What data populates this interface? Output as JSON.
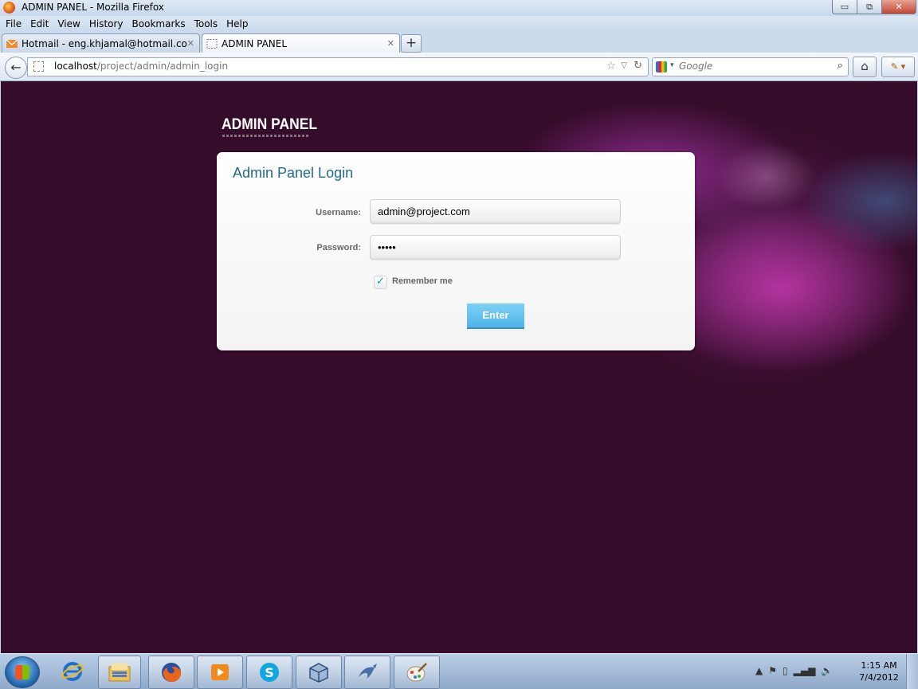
{
  "window": {
    "title": "ADMIN PANEL - Mozilla Firefox",
    "minimize": "▭",
    "restore": "⧉",
    "close": "✕"
  },
  "menu": [
    "File",
    "Edit",
    "View",
    "History",
    "Bookmarks",
    "Tools",
    "Help"
  ],
  "tabs": [
    {
      "label": "Hotmail - eng.khjamal@hotmail.com",
      "icon": "hotmail-icon",
      "close": "✕"
    },
    {
      "label": "ADMIN PANEL",
      "icon": "blank-page-icon",
      "close": "✕"
    }
  ],
  "newtab": "+",
  "nav": {
    "url_host": "localhost",
    "url_path": "/project/admin/admin_login",
    "search_engine": "Google",
    "search_placeholder": "Google"
  },
  "page": {
    "logo_text": "ADMIN PANEL",
    "panel_title": "Admin Panel Login",
    "username_label": "Username:",
    "username_value": "admin@project.com",
    "password_label": "Password:",
    "password_value": "•••••",
    "remember_label": "Remember me",
    "remember_checked": true,
    "enter_label": "Enter"
  },
  "taskbar": {
    "apps": [
      "start",
      "internet-explorer",
      "file-explorer",
      "firefox",
      "media-player",
      "skype",
      "virtualbox",
      "mysql",
      "paint"
    ],
    "time": "1:15 AM",
    "date": "7/4/2012"
  },
  "colors": {
    "page_bg": "#360c2b",
    "accent": "#226b8c",
    "button": "#5bbcec"
  }
}
